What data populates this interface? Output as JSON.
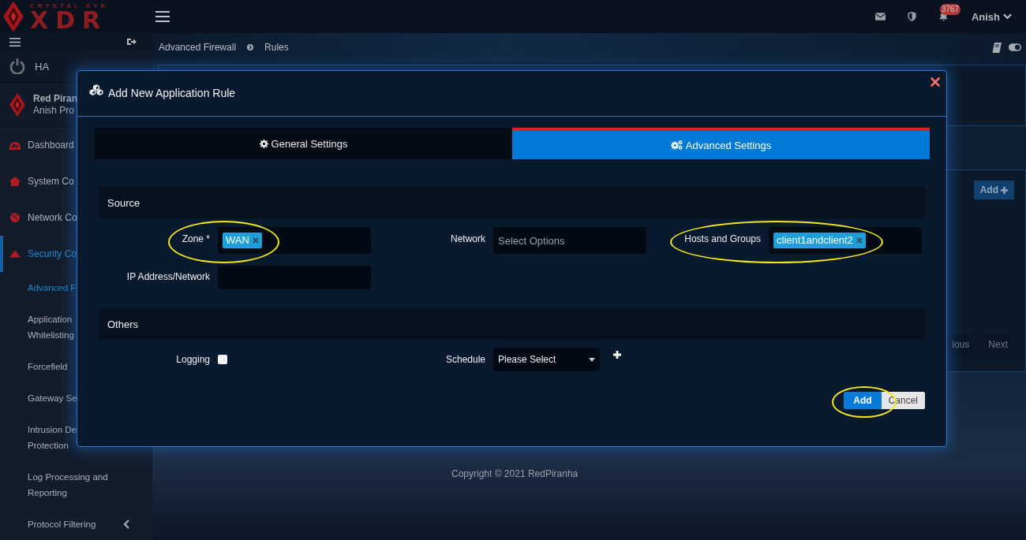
{
  "header": {
    "logo_caption": "CRYSTAL EYE",
    "logo_title": "XDR",
    "notification_count": "3767",
    "user": "Anish"
  },
  "sidebar": {
    "items": [
      {
        "kind": "power",
        "label": "HA",
        "selected": false,
        "expandable": false
      },
      {
        "kind": "profile",
        "label": "Red Piran",
        "sublabel": "Anish Pro",
        "selected": false,
        "expandable": false
      },
      {
        "kind": "nav",
        "label": "Dashboard",
        "selected": false,
        "expandable": false
      },
      {
        "kind": "nav",
        "label": "System Co",
        "selected": false,
        "expandable": false
      },
      {
        "kind": "nav",
        "label": "Network Co",
        "selected": false,
        "expandable": false
      },
      {
        "kind": "nav",
        "label": "Security Co",
        "selected": true,
        "expandable": false
      },
      {
        "kind": "sub",
        "lines": [
          "Advanced F"
        ],
        "selected": true,
        "expandable": false
      },
      {
        "kind": "sub",
        "lines": [
          "Application",
          "Whitelisting"
        ],
        "selected": false,
        "expandable": false
      },
      {
        "kind": "sub",
        "lines": [
          "Forcefield"
        ],
        "selected": false,
        "expandable": false
      },
      {
        "kind": "sub",
        "lines": [
          "Gateway Se"
        ],
        "selected": false,
        "expandable": false
      },
      {
        "kind": "sub",
        "lines": [
          "Intrusion De",
          "Protection"
        ],
        "selected": false,
        "expandable": false
      },
      {
        "kind": "sub",
        "lines": [
          "Log Processing and",
          "Reporting"
        ],
        "selected": false,
        "expandable": false
      },
      {
        "kind": "sub",
        "lines": [
          "Protocol Filtering"
        ],
        "selected": false,
        "expandable": true
      }
    ]
  },
  "breadcrumb": [
    "Advanced Firewall",
    "Rules"
  ],
  "main": {
    "add_button": "Add",
    "pagination": [
      "ious",
      "Next"
    ],
    "footer": "Copyright © 2021 RedPiranha"
  },
  "modal": {
    "title": "Add New Application Rule",
    "tabs": [
      {
        "label": "General Settings",
        "selected": false
      },
      {
        "label": "Advanced Settings",
        "selected": true
      }
    ],
    "sections": [
      {
        "title": "Source",
        "fields": [
          {
            "kind": "tags",
            "label": "Zone *",
            "tags": [
              "WAN"
            ],
            "highlighted": true
          },
          {
            "kind": "input",
            "label": "Network",
            "placeholder": "Select Options",
            "highlighted": false
          },
          {
            "kind": "tags",
            "label": "Hosts and Groups",
            "tags": [
              "client1andclient2"
            ],
            "highlighted": true
          },
          {
            "kind": "input",
            "label": "IP Address/Network",
            "highlighted": false
          }
        ]
      },
      {
        "title": "Others",
        "fields": [
          {
            "kind": "checkbox",
            "label": "Logging",
            "checked": false,
            "highlighted": false
          },
          {
            "kind": "select",
            "label": "Schedule",
            "value": "Please Select",
            "highlighted": false
          }
        ]
      }
    ],
    "buttons": [
      {
        "kind": "primary",
        "label": "Add",
        "highlighted": true
      },
      {
        "kind": "default",
        "label": "Cancel",
        "highlighted": false
      }
    ]
  }
}
